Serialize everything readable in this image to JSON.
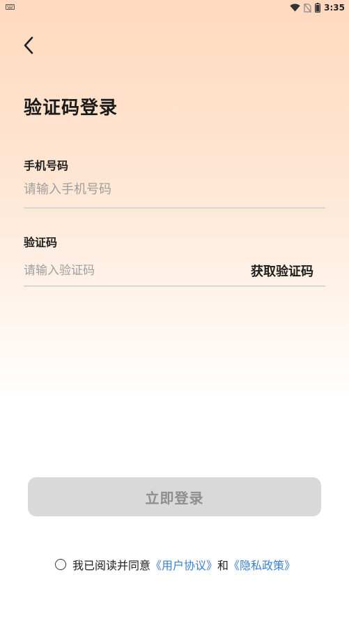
{
  "status_bar": {
    "time": "3:35"
  },
  "header": {
    "title": "验证码登录"
  },
  "form": {
    "phone": {
      "label": "手机号码",
      "placeholder": "请输入手机号码",
      "value": ""
    },
    "code": {
      "label": "验证码",
      "placeholder": "请输入验证码",
      "value": "",
      "get_code_label": "获取验证码"
    },
    "submit_label": "立即登录"
  },
  "agreement": {
    "prefix": "我已阅读并同意",
    "user_agreement": "《用户协议》",
    "conjunction": "和",
    "privacy_policy": "《隐私政策》"
  },
  "colors": {
    "link": "#3a7fcf",
    "button_disabled_bg": "#d9d9d9",
    "button_disabled_text": "#8e8e8e",
    "gradient_top": "#ffd9bf"
  }
}
